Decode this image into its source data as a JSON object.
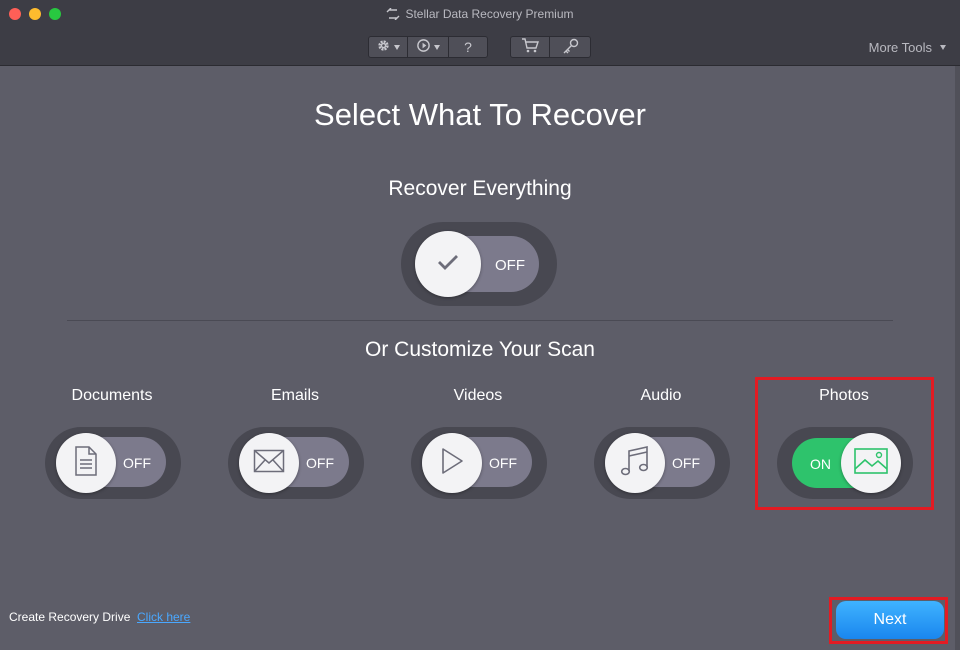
{
  "window": {
    "title": "Stellar Data Recovery Premium"
  },
  "toolbar": {
    "settings_icon": "gear-icon",
    "history_icon": "history-icon",
    "help_label": "?",
    "cart_icon": "cart-icon",
    "key_icon": "key-icon",
    "more_tools": "More Tools"
  },
  "main": {
    "title": "Select What To Recover",
    "recover_everything": {
      "label": "Recover Everything",
      "state": "OFF",
      "icon": "checkmark-icon"
    },
    "customize_label": "Or Customize Your Scan",
    "categories": [
      {
        "label": "Documents",
        "state": "OFF",
        "icon": "document-icon",
        "on": false
      },
      {
        "label": "Emails",
        "state": "OFF",
        "icon": "envelope-icon",
        "on": false
      },
      {
        "label": "Videos",
        "state": "OFF",
        "icon": "play-icon",
        "on": false
      },
      {
        "label": "Audio",
        "state": "OFF",
        "icon": "music-note-icon",
        "on": false
      },
      {
        "label": "Photos",
        "state": "ON",
        "icon": "image-icon",
        "on": true
      }
    ]
  },
  "footer": {
    "recovery_drive_label": "Create Recovery Drive",
    "recovery_drive_link": "Click here",
    "next_label": "Next"
  },
  "colors": {
    "background": "#5d5d68",
    "toggle_on": "#2ec36c",
    "toggle_off": "#7c7a8c",
    "highlight": "#e31b23",
    "next_button": "#1a86ee",
    "link": "#4aa8ff"
  }
}
